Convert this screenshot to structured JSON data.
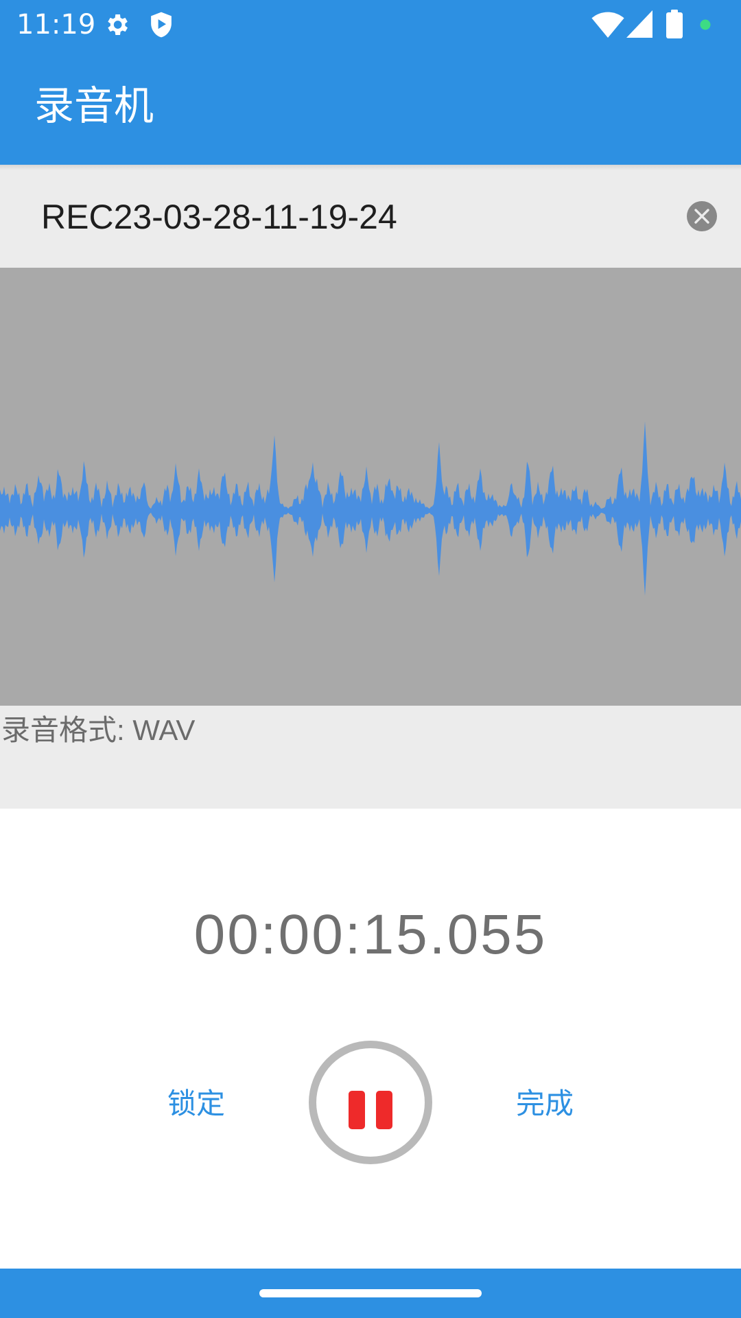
{
  "status_bar": {
    "time": "11:19",
    "left_icons": [
      "gear-icon",
      "shield-play-icon"
    ],
    "right_icons": [
      "wifi-icon",
      "cell-signal-icon",
      "battery-icon",
      "green-dot-icon"
    ]
  },
  "app_bar": {
    "title": "录音机",
    "background_color": "#2d90e2"
  },
  "recording": {
    "filename": "REC23-03-28-11-19-24",
    "clear_icon": "close-circle-icon",
    "format_label": "录音格式: WAV",
    "elapsed": "00:00:15.055"
  },
  "waveform": {
    "background_color": "#a9a9a9",
    "wave_color": "#4a8fe0"
  },
  "controls": {
    "lock_label": "锁定",
    "done_label": "完成",
    "pause_icon": "pause-icon",
    "accent_color": "#2d90e2",
    "record_color": "#ee2a2a"
  },
  "nav_bar": {
    "home_indicator": "home-pill"
  }
}
